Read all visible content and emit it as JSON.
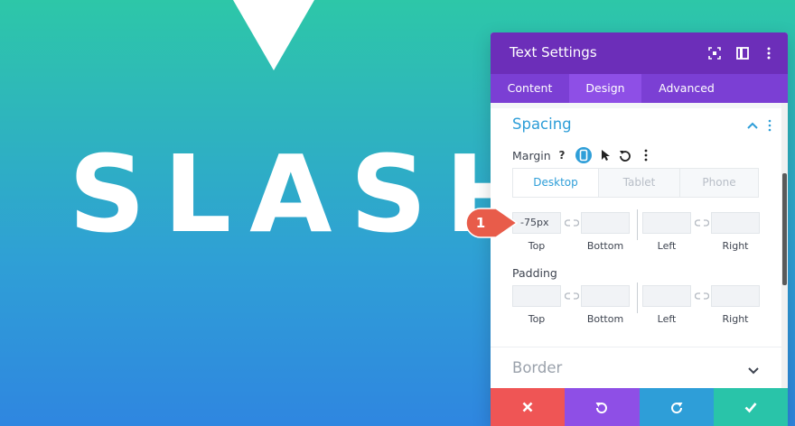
{
  "canvas": {
    "hero_text": "SLASH"
  },
  "panel": {
    "title": "Text Settings",
    "tabs": [
      {
        "label": "Content"
      },
      {
        "label": "Design"
      },
      {
        "label": "Advanced"
      }
    ],
    "active_tab": "Design",
    "spacing": {
      "title": "Spacing",
      "margin": {
        "label": "Margin",
        "help_glyph": "?",
        "devices": [
          "Desktop",
          "Tablet",
          "Phone"
        ],
        "active_device": "Desktop",
        "fields": [
          {
            "caption": "Top",
            "value": "-75px"
          },
          {
            "caption": "Bottom",
            "value": ""
          },
          {
            "caption": "Left",
            "value": ""
          },
          {
            "caption": "Right",
            "value": ""
          }
        ]
      },
      "padding": {
        "label": "Padding",
        "fields": [
          {
            "caption": "Top",
            "value": ""
          },
          {
            "caption": "Bottom",
            "value": ""
          },
          {
            "caption": "Left",
            "value": ""
          },
          {
            "caption": "Right",
            "value": ""
          }
        ]
      }
    },
    "border": {
      "title": "Border"
    }
  },
  "annotation": {
    "number": "1",
    "color": "#e85c4a"
  },
  "colors": {
    "header": "#6c2eb9",
    "tabs": "#7b3fd4",
    "active_tab": "#8e4fe6",
    "accent": "#2e9ed8",
    "cancel": "#ef5555",
    "undo": "#8e4fe6",
    "redo": "#2e9ed8",
    "save": "#29c4a9"
  },
  "icons": {
    "header": [
      "focus-icon",
      "split-view-icon",
      "more-vertical-icon"
    ],
    "actions": [
      "close-icon",
      "undo-icon",
      "redo-icon",
      "check-icon"
    ]
  }
}
